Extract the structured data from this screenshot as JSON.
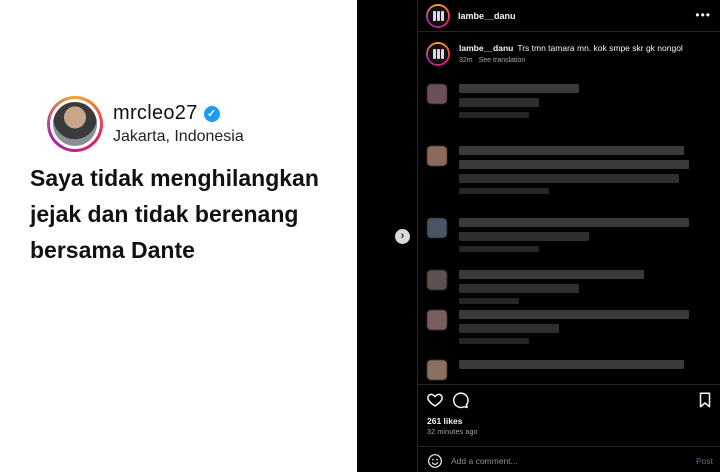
{
  "media": {
    "username": "mrcleo27",
    "verified_mark": "✓",
    "location": "Jakarta, Indonesia",
    "quote": "Saya tidak menghilangkan jejak dan tidak berenang bersama Dante"
  },
  "nav": {
    "next_icon": "›"
  },
  "header": {
    "username": "lambe__danu",
    "more_icon": "•••"
  },
  "caption": {
    "username": "lambe__danu",
    "text": "Trs tmn tamara mn. kok smpe skr gk nongol",
    "time": "32m",
    "see_translation": "See translation"
  },
  "comments_note": "blurred",
  "likes": "261 likes",
  "time_ago": "32 minutes ago",
  "comment_box": {
    "placeholder": "Add a comment...",
    "post_label": "Post"
  },
  "colors": {
    "verified": "#1d9bf0",
    "panel_bg": "#000000",
    "divider": "#262626"
  }
}
